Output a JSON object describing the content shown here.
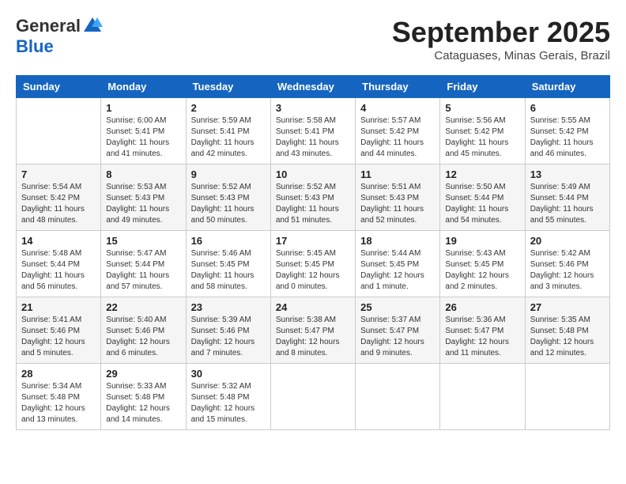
{
  "logo": {
    "general": "General",
    "blue": "Blue"
  },
  "header": {
    "month": "September 2025",
    "location": "Cataguases, Minas Gerais, Brazil"
  },
  "days": [
    "Sunday",
    "Monday",
    "Tuesday",
    "Wednesday",
    "Thursday",
    "Friday",
    "Saturday"
  ],
  "weeks": [
    [
      {
        "day": "",
        "sunrise": "",
        "sunset": "",
        "daylight": ""
      },
      {
        "day": "1",
        "sunrise": "Sunrise: 6:00 AM",
        "sunset": "Sunset: 5:41 PM",
        "daylight": "Daylight: 11 hours and 41 minutes."
      },
      {
        "day": "2",
        "sunrise": "Sunrise: 5:59 AM",
        "sunset": "Sunset: 5:41 PM",
        "daylight": "Daylight: 11 hours and 42 minutes."
      },
      {
        "day": "3",
        "sunrise": "Sunrise: 5:58 AM",
        "sunset": "Sunset: 5:41 PM",
        "daylight": "Daylight: 11 hours and 43 minutes."
      },
      {
        "day": "4",
        "sunrise": "Sunrise: 5:57 AM",
        "sunset": "Sunset: 5:42 PM",
        "daylight": "Daylight: 11 hours and 44 minutes."
      },
      {
        "day": "5",
        "sunrise": "Sunrise: 5:56 AM",
        "sunset": "Sunset: 5:42 PM",
        "daylight": "Daylight: 11 hours and 45 minutes."
      },
      {
        "day": "6",
        "sunrise": "Sunrise: 5:55 AM",
        "sunset": "Sunset: 5:42 PM",
        "daylight": "Daylight: 11 hours and 46 minutes."
      }
    ],
    [
      {
        "day": "7",
        "sunrise": "Sunrise: 5:54 AM",
        "sunset": "Sunset: 5:42 PM",
        "daylight": "Daylight: 11 hours and 48 minutes."
      },
      {
        "day": "8",
        "sunrise": "Sunrise: 5:53 AM",
        "sunset": "Sunset: 5:43 PM",
        "daylight": "Daylight: 11 hours and 49 minutes."
      },
      {
        "day": "9",
        "sunrise": "Sunrise: 5:52 AM",
        "sunset": "Sunset: 5:43 PM",
        "daylight": "Daylight: 11 hours and 50 minutes."
      },
      {
        "day": "10",
        "sunrise": "Sunrise: 5:52 AM",
        "sunset": "Sunset: 5:43 PM",
        "daylight": "Daylight: 11 hours and 51 minutes."
      },
      {
        "day": "11",
        "sunrise": "Sunrise: 5:51 AM",
        "sunset": "Sunset: 5:43 PM",
        "daylight": "Daylight: 11 hours and 52 minutes."
      },
      {
        "day": "12",
        "sunrise": "Sunrise: 5:50 AM",
        "sunset": "Sunset: 5:44 PM",
        "daylight": "Daylight: 11 hours and 54 minutes."
      },
      {
        "day": "13",
        "sunrise": "Sunrise: 5:49 AM",
        "sunset": "Sunset: 5:44 PM",
        "daylight": "Daylight: 11 hours and 55 minutes."
      }
    ],
    [
      {
        "day": "14",
        "sunrise": "Sunrise: 5:48 AM",
        "sunset": "Sunset: 5:44 PM",
        "daylight": "Daylight: 11 hours and 56 minutes."
      },
      {
        "day": "15",
        "sunrise": "Sunrise: 5:47 AM",
        "sunset": "Sunset: 5:44 PM",
        "daylight": "Daylight: 11 hours and 57 minutes."
      },
      {
        "day": "16",
        "sunrise": "Sunrise: 5:46 AM",
        "sunset": "Sunset: 5:45 PM",
        "daylight": "Daylight: 11 hours and 58 minutes."
      },
      {
        "day": "17",
        "sunrise": "Sunrise: 5:45 AM",
        "sunset": "Sunset: 5:45 PM",
        "daylight": "Daylight: 12 hours and 0 minutes."
      },
      {
        "day": "18",
        "sunrise": "Sunrise: 5:44 AM",
        "sunset": "Sunset: 5:45 PM",
        "daylight": "Daylight: 12 hours and 1 minute."
      },
      {
        "day": "19",
        "sunrise": "Sunrise: 5:43 AM",
        "sunset": "Sunset: 5:45 PM",
        "daylight": "Daylight: 12 hours and 2 minutes."
      },
      {
        "day": "20",
        "sunrise": "Sunrise: 5:42 AM",
        "sunset": "Sunset: 5:46 PM",
        "daylight": "Daylight: 12 hours and 3 minutes."
      }
    ],
    [
      {
        "day": "21",
        "sunrise": "Sunrise: 5:41 AM",
        "sunset": "Sunset: 5:46 PM",
        "daylight": "Daylight: 12 hours and 5 minutes."
      },
      {
        "day": "22",
        "sunrise": "Sunrise: 5:40 AM",
        "sunset": "Sunset: 5:46 PM",
        "daylight": "Daylight: 12 hours and 6 minutes."
      },
      {
        "day": "23",
        "sunrise": "Sunrise: 5:39 AM",
        "sunset": "Sunset: 5:46 PM",
        "daylight": "Daylight: 12 hours and 7 minutes."
      },
      {
        "day": "24",
        "sunrise": "Sunrise: 5:38 AM",
        "sunset": "Sunset: 5:47 PM",
        "daylight": "Daylight: 12 hours and 8 minutes."
      },
      {
        "day": "25",
        "sunrise": "Sunrise: 5:37 AM",
        "sunset": "Sunset: 5:47 PM",
        "daylight": "Daylight: 12 hours and 9 minutes."
      },
      {
        "day": "26",
        "sunrise": "Sunrise: 5:36 AM",
        "sunset": "Sunset: 5:47 PM",
        "daylight": "Daylight: 12 hours and 11 minutes."
      },
      {
        "day": "27",
        "sunrise": "Sunrise: 5:35 AM",
        "sunset": "Sunset: 5:48 PM",
        "daylight": "Daylight: 12 hours and 12 minutes."
      }
    ],
    [
      {
        "day": "28",
        "sunrise": "Sunrise: 5:34 AM",
        "sunset": "Sunset: 5:48 PM",
        "daylight": "Daylight: 12 hours and 13 minutes."
      },
      {
        "day": "29",
        "sunrise": "Sunrise: 5:33 AM",
        "sunset": "Sunset: 5:48 PM",
        "daylight": "Daylight: 12 hours and 14 minutes."
      },
      {
        "day": "30",
        "sunrise": "Sunrise: 5:32 AM",
        "sunset": "Sunset: 5:48 PM",
        "daylight": "Daylight: 12 hours and 15 minutes."
      },
      {
        "day": "",
        "sunrise": "",
        "sunset": "",
        "daylight": ""
      },
      {
        "day": "",
        "sunrise": "",
        "sunset": "",
        "daylight": ""
      },
      {
        "day": "",
        "sunrise": "",
        "sunset": "",
        "daylight": ""
      },
      {
        "day": "",
        "sunrise": "",
        "sunset": "",
        "daylight": ""
      }
    ]
  ]
}
